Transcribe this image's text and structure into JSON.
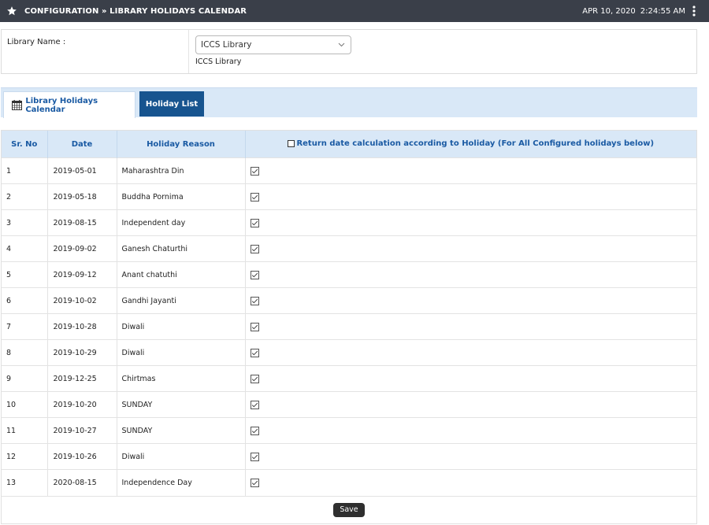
{
  "header": {
    "breadcrumb": "CONFIGURATION » LIBRARY HOLIDAYS CALENDAR",
    "date": "APR 10, 2020",
    "time": "2:24:55 AM"
  },
  "library": {
    "label": "Library Name :",
    "selected": "ICCS Library",
    "caption": "ICCS Library"
  },
  "tabs": [
    {
      "label": "Library Holidays Calendar",
      "active": false
    },
    {
      "label": "Holiday List",
      "active": true
    }
  ],
  "table": {
    "columns": [
      "Sr. No",
      "Date",
      "Holiday Reason",
      "Return date calculation according to Holiday (For All Configured holidays below)"
    ],
    "header_checkbox_checked": false,
    "rows": [
      {
        "sr": "1",
        "date": "2019-05-01",
        "reason": "Maharashtra Din",
        "checked": true
      },
      {
        "sr": "2",
        "date": "2019-05-18",
        "reason": "Buddha Pornima",
        "checked": true
      },
      {
        "sr": "3",
        "date": "2019-08-15",
        "reason": "Independent day",
        "checked": true
      },
      {
        "sr": "4",
        "date": "2019-09-02",
        "reason": "Ganesh Chaturthi",
        "checked": true
      },
      {
        "sr": "5",
        "date": "2019-09-12",
        "reason": "Anant chatuthi",
        "checked": true
      },
      {
        "sr": "6",
        "date": "2019-10-02",
        "reason": "Gandhi Jayanti",
        "checked": true
      },
      {
        "sr": "7",
        "date": "2019-10-28",
        "reason": "Diwali",
        "checked": true
      },
      {
        "sr": "8",
        "date": "2019-10-29",
        "reason": "Diwali",
        "checked": true
      },
      {
        "sr": "9",
        "date": "2019-12-25",
        "reason": "Chirtmas",
        "checked": true
      },
      {
        "sr": "10",
        "date": "2019-10-20",
        "reason": "SUNDAY",
        "checked": true
      },
      {
        "sr": "11",
        "date": "2019-10-27",
        "reason": "SUNDAY",
        "checked": true
      },
      {
        "sr": "12",
        "date": "2019-10-26",
        "reason": "Diwali",
        "checked": true
      },
      {
        "sr": "13",
        "date": "2020-08-15",
        "reason": "Independence Day",
        "checked": true
      }
    ]
  },
  "actions": {
    "save_label": "Save"
  },
  "colors": {
    "topbar": "#3a3f49",
    "tab_strip": "#d9e8f7",
    "active_tab": "#17548f",
    "header_text": "#1a5aa3",
    "save_button": "#2f2f2f"
  }
}
